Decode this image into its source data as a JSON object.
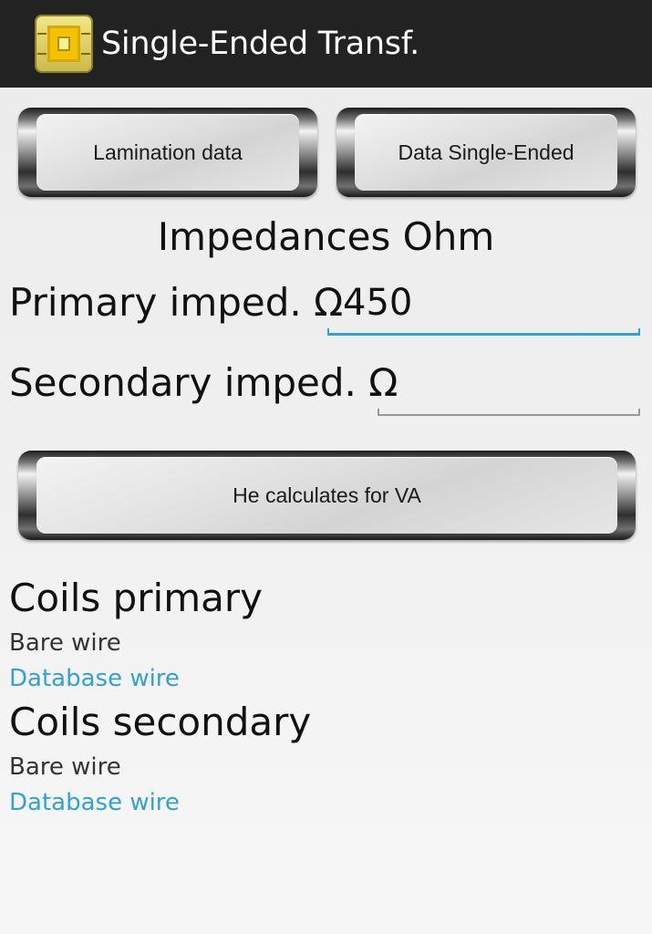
{
  "action_bar": {
    "title": "Single-Ended Transf.",
    "icon": "transformer-app-icon"
  },
  "buttons": {
    "lamination_data": "Lamination data",
    "data_single_ended": "Data Single-Ended",
    "calculate": "He calculates for VA"
  },
  "impedances": {
    "heading": "Impedances Ohm",
    "primary_label": "Primary imped. Ω",
    "primary_value": "450",
    "secondary_label": "Secondary imped. Ω",
    "secondary_value": ""
  },
  "coils_primary": {
    "title": "Coils primary",
    "bare_wire": "Bare wire",
    "database_link": "Database wire"
  },
  "coils_secondary": {
    "title": "Coils secondary",
    "bare_wire": "Bare wire",
    "database_link": "Database wire"
  },
  "colors": {
    "action_bar": "#222222",
    "accent": "#33a1d6"
  }
}
